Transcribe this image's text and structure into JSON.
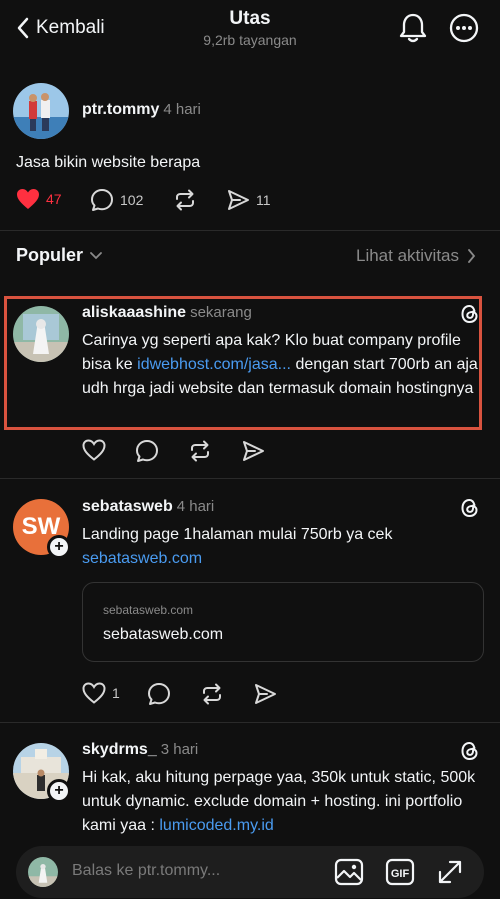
{
  "header": {
    "back_label": "Kembali",
    "title": "Utas",
    "views": "9,2rb tayangan"
  },
  "main_post": {
    "username": "ptr.tommy",
    "time": "4 hari",
    "text": "Jasa bikin website berapa",
    "likes": "47",
    "comments": "102",
    "shares": "11"
  },
  "sort": {
    "label": "Populer",
    "activity_label": "Lihat aktivitas"
  },
  "replies": [
    {
      "username": "aliskaaashine",
      "time": "sekarang",
      "text_before": "Carinya yg seperti apa kak? Klo buat company profile bisa ke ",
      "link": "idwebhost.com/jasa...",
      "text_after": " dengan start 700rb an aja udh hrga jadi website dan termasuk domain hostingnya"
    },
    {
      "username": "sebatasweb",
      "time": "4 hari",
      "avatar_text": "SW",
      "text": "Landing page 1halaman mulai 750rb ya cek",
      "link": "sebatasweb.com",
      "preview_domain": "sebatasweb.com",
      "preview_title": "sebatasweb.com",
      "likes": "1"
    },
    {
      "username": "skydrms_",
      "time": "3 hari",
      "text": "Hi kak, aku hitung perpage yaa, 350k untuk static, 500k untuk dynamic. exclude domain + hosting. ini portfolio kami yaa : ",
      "link": "lumicoded.my.id"
    }
  ],
  "reply_bar": {
    "placeholder": "Balas ke ptr.tommy..."
  },
  "colors": {
    "background": "#101010",
    "like_red": "#ff3040",
    "link_blue": "#4a9bf0",
    "highlight_border": "#d9533f",
    "sebatasweb_avatar": "#e8703a"
  }
}
